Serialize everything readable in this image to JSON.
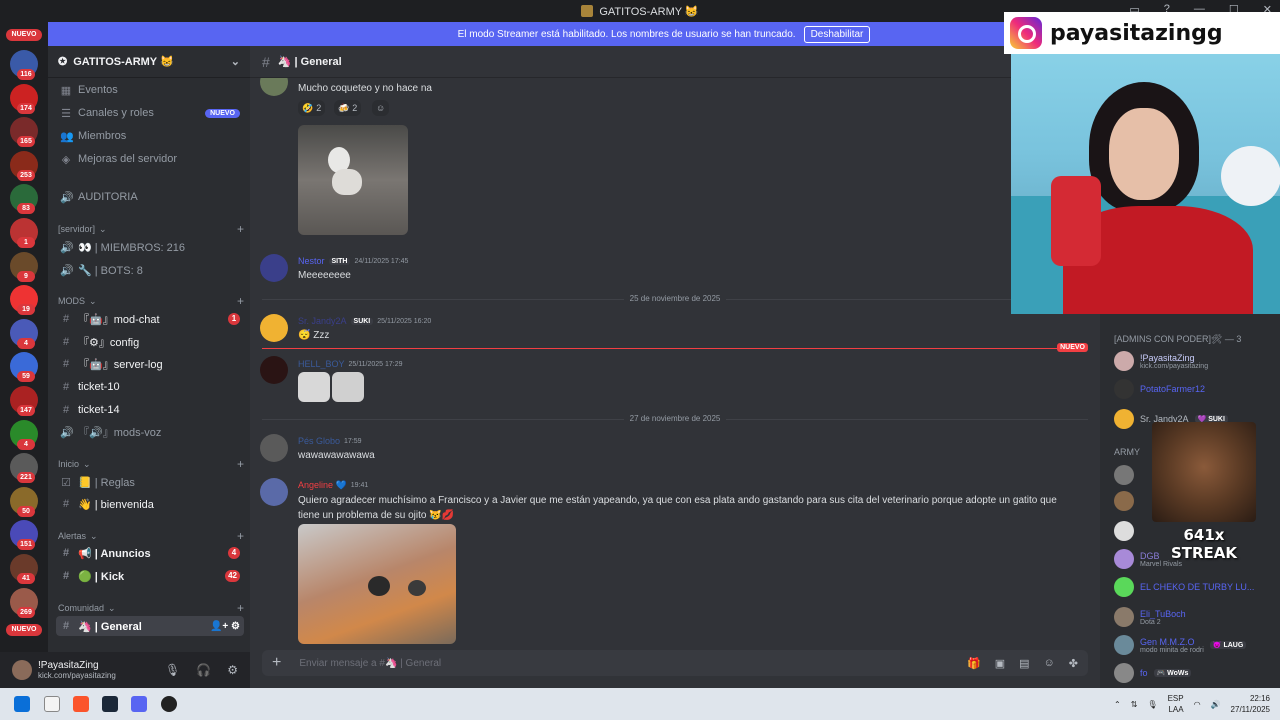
{
  "window": {
    "title": "GATITOS-ARMY 😸"
  },
  "banner": {
    "text": "El modo Streamer está habilitado. Los nombres de usuario se han truncado.",
    "button": "Deshabilitar"
  },
  "servers": {
    "top_label": "NUEVO",
    "bottom_label": "NUEVO",
    "badges": [
      "116",
      "174",
      "165",
      "253",
      "83",
      "1",
      "9",
      "19",
      "4",
      "59",
      "147",
      "4",
      "221",
      "50",
      "151",
      "41",
      "269"
    ]
  },
  "server_header": {
    "name": "GATITOS-ARMY 😸"
  },
  "channels": {
    "top": [
      {
        "label": "Eventos"
      },
      {
        "label": "Canales y roles",
        "tag": "NUEVO"
      },
      {
        "label": "Miembros"
      },
      {
        "label": "Mejoras del servidor"
      }
    ],
    "auditoria": "AUDITORIA",
    "cat_servidor": "[servidor]",
    "miembros": "👀 | MIEMBROS: 216",
    "bots": "🔧 | BOTS: 8",
    "cat_mods": "MODS",
    "mods": [
      {
        "label": "『🤖』mod-chat",
        "badge": "1"
      },
      {
        "label": "『⚙』config"
      },
      {
        "label": "『🤖』server-log"
      },
      {
        "label": "ticket-10"
      },
      {
        "label": "ticket-14"
      },
      {
        "label": "『🔊』mods-voz"
      }
    ],
    "cat_inicio": "Inicio",
    "inicio": [
      {
        "label": "📒 | Reglas"
      },
      {
        "label": "👋 | bienvenida"
      }
    ],
    "cat_alertas": "Alertas",
    "alertas": [
      {
        "label": "📢 | Anuncios",
        "badge": "4"
      },
      {
        "label": "🟢 | Kick",
        "badge": "42"
      }
    ],
    "cat_comunidad": "Comunidad",
    "general": "🦄 | General"
  },
  "user_panel": {
    "name": "!PayasitaZing",
    "sub": "kick.com/payasitazing"
  },
  "chat": {
    "channel_title": "🦄 | General",
    "msg1_text": "Mucho coqueteo y no hace na",
    "reactions": [
      {
        "emoji": "🤣",
        "count": "2"
      },
      {
        "emoji": "🍻",
        "count": "2"
      }
    ],
    "msg2": {
      "author": "Nestor",
      "tag": "SITH",
      "time": "24/11/2025 17:45",
      "text": "Meeeeeeee"
    },
    "date1": "25 de noviembre de 2025",
    "msg3": {
      "author": "Sr. Jandy2A",
      "tag": "SUKI",
      "time": "25/11/2025 16:20",
      "text": "😴 Zzz"
    },
    "new_label": "NUEVO",
    "msg4": {
      "author": "HELL_BOY",
      "time": "25/11/2025 17:29"
    },
    "date2": "27 de noviembre de 2025",
    "msg5": {
      "author": "Pés Globo",
      "time": "17:59",
      "text": "wawawawawawa"
    },
    "msg6": {
      "author": "Angeline 💙",
      "time": "19:41",
      "text": "Quiero agradecer muchísimo a Francisco y a Javier que me están yapeando, ya que con esa plata ando gastando para sus cita del veterinario porque adopte un gatito que tiene un problema de su ojito 😿💋"
    },
    "composer_placeholder": "Enviar mensaje a #🦄 | General"
  },
  "members": {
    "group1": "[ADMINS CON PODER]🛠 — 3",
    "group2": "ARMY",
    "rows": [
      {
        "name": "!PayasitaZing",
        "sub": "kick.com/payasitazing",
        "color": "#c9cdfb"
      },
      {
        "name": "PotatoFarmer12",
        "sub": "",
        "color": "#5865f2"
      },
      {
        "name": "Sr. Jandy2A",
        "sub": "",
        "tag": "💜 SUKI",
        "color": "#b5bac1"
      },
      {
        "name": "",
        "sub": "",
        "color": "#b5bac1"
      },
      {
        "name": "",
        "sub": "",
        "color": "#b5bac1"
      },
      {
        "name": "",
        "sub": "",
        "color": "#b5bac1"
      },
      {
        "name": "DGB",
        "sub": "Marvel Rivals",
        "color": "#8a7dd8"
      },
      {
        "name": "EL CHEKO DE TURBY LU...",
        "sub": "",
        "color": "#5865f2"
      },
      {
        "name": "Eli_TuBoch",
        "sub": "Dota 2",
        "color": "#5865f2"
      },
      {
        "name": "Gen M.M.Z.O",
        "tag": "😈 LAUG",
        "sub": "modo minita de rodri",
        "color": "#5865f2"
      },
      {
        "name": "fo",
        "tag": "🎮 WoWs",
        "sub": "",
        "color": "#5865f2"
      }
    ]
  },
  "overlay": {
    "instagram": "payasitazingg",
    "streak": "641x STREAK"
  },
  "taskbar": {
    "lang1": "ESP",
    "lang2": "LAA",
    "time": "22:16",
    "date": "27/11/2025"
  }
}
